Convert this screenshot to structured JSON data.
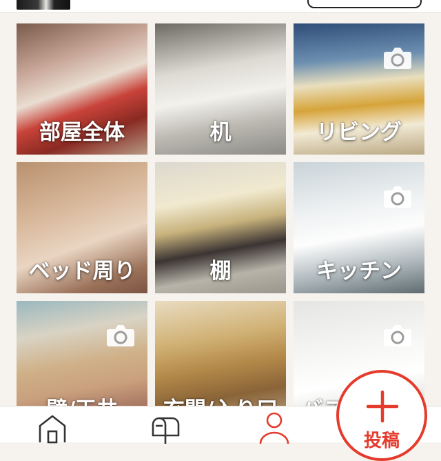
{
  "tiles": [
    {
      "label": "部屋全体",
      "camera": false,
      "bg": "linear-gradient(160deg,#7a5a4a 0%,#c9a89a 30%,#e9ddd1 48%,#c8433a 62%,#8a2a22 78%,#b59a84 100%)"
    },
    {
      "label": "机",
      "camera": false,
      "bg": "linear-gradient(170deg,#6c6a63 0%,#dcdad2 35%,#f2f1ec 55%,#bdbab3 75%,#8c8b86 100%)"
    },
    {
      "label": "リビング",
      "camera": true,
      "bg": "linear-gradient(175deg,#2f4d78 0%,#6c8fb0 28%,#e9dfbe 45%,#d6a43a 62%,#f2ead5 78%,#b9a883 100%)"
    },
    {
      "label": "ベッド周り",
      "camera": false,
      "bg": "linear-gradient(160deg,#b9916f 0%,#d8b79a 35%,#e9d5c2 60%,#9a7058 85%,#7b5444 100%)"
    },
    {
      "label": "棚",
      "camera": false,
      "bg": "linear-gradient(170deg,#dcd8cf 0%,#f1e9cf 30%,#c7b27c 48%,#3b3433 65%,#b7b3a8 82%,#9a968d 100%)"
    },
    {
      "label": "キッチン",
      "camera": true,
      "bg": "linear-gradient(170deg,#c9d3d8 0%,#eef1f2 35%,#fdfdfd 55%,#a8b2b6 80%,#5f6b70 100%)"
    },
    {
      "label": "壁/天井",
      "camera": true,
      "bg": "linear-gradient(170deg,#9ab8bf 0%,#d9d3c4 25%,#cfb087 48%,#c9a07d 65%,#a36f5e 85%,#d8c8b2 100%)"
    },
    {
      "label": "玄関/入り口",
      "camera": false,
      "bg": "linear-gradient(170deg,#e9dcc1 0%,#d1b276 30%,#b48949 50%,#8a6438 70%,#c7b49d 100%)"
    },
    {
      "label": "バス/トイレ",
      "camera": true,
      "bg": "linear-gradient(170deg,#e5e5e3 0%,#f7f7f5 40%,#ffffff 60%,#dcdcd8 85%,#b8b8b3 100%)"
    }
  ],
  "nav": {
    "items": [
      {
        "name": "home",
        "icon": "home-icon"
      },
      {
        "name": "mail",
        "icon": "mailbox-icon"
      },
      {
        "name": "mypage",
        "icon": "user-icon"
      }
    ],
    "post_label": "投稿",
    "accent": "#e53b2c"
  }
}
